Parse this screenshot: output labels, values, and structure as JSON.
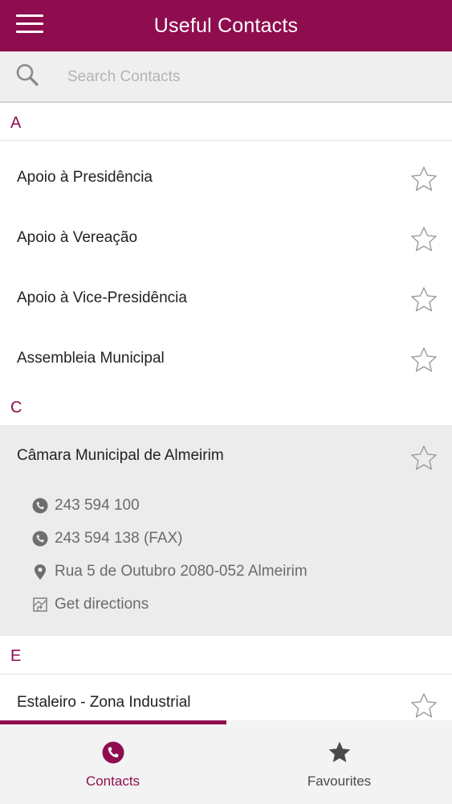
{
  "header": {
    "title": "Useful Contacts"
  },
  "search": {
    "placeholder": "Search Contacts"
  },
  "sections": [
    {
      "letter": "A",
      "contacts": [
        "Apoio à Presidência",
        "Apoio à Vereação",
        "Apoio à Vice-Presidência",
        "Assembleia Municipal"
      ]
    },
    {
      "letter": "C",
      "contacts": [
        "Câmara Municipal de Almeirim"
      ]
    },
    {
      "letter": "E",
      "contacts": [
        "Estaleiro - Zona Industrial"
      ]
    }
  ],
  "expanded_contact": {
    "phone": "243 594 100",
    "fax": "243 594 138 (FAX)",
    "address": "Rua 5 de Outubro 2080-052 Almeirim",
    "directions": "Get directions"
  },
  "tabs": [
    {
      "label": "Contacts",
      "icon": "phone-icon",
      "active": true
    },
    {
      "label": "Favourites",
      "icon": "star-filled-icon",
      "active": false
    }
  ],
  "colors": {
    "brand": "#8f0d4f",
    "detail_text": "#6b6b6b",
    "expanded_bg": "#ececec"
  }
}
